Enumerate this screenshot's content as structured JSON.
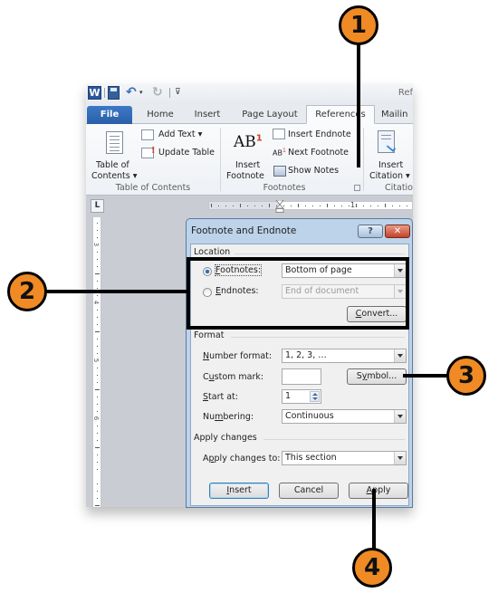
{
  "window": {
    "title_fragment": "Ref",
    "app_icon_letter": "W"
  },
  "quick_access": {
    "save_icon": "save-icon",
    "undo_icon": "undo-icon",
    "redo_icon": "redo-icon",
    "undo_glyph": "↶",
    "redo_glyph": "↻",
    "dropdown_glyph": "▾",
    "customize_glyph": "⊽"
  },
  "tabs": [
    {
      "label": "File"
    },
    {
      "label": "Home"
    },
    {
      "label": "Insert"
    },
    {
      "label": "Page Layout"
    },
    {
      "label": "References",
      "active": true
    },
    {
      "label": "Mailin"
    }
  ],
  "ribbon": {
    "toc_group": {
      "label": "Table of Contents",
      "toc_button_line1": "Table of",
      "toc_button_line2": "Contents ▾",
      "add_text": "Add Text ▾",
      "update_table": "Update Table"
    },
    "footnotes_group": {
      "label": "Footnotes",
      "insert_footnote_line1": "Insert",
      "insert_footnote_line2": "Footnote",
      "insert_endnote": "Insert Endnote",
      "next_footnote": "Next Footnote",
      "show_notes": "Show Notes",
      "ab_glyph": "AB",
      "ab_sup": "1"
    },
    "citations_group": {
      "label": "Citatio",
      "insert_citation_line1": "Insert",
      "insert_citation_line2": "Citation ▾"
    }
  },
  "ruler": {
    "corner_glyph": "L",
    "vertical_numbers": [
      "3",
      "4",
      "5",
      "6"
    ],
    "horizontal_number": "1"
  },
  "dialog": {
    "title": "Footnote and Endnote",
    "help_glyph": "?",
    "close_glyph": "✕",
    "location": {
      "section_label": "Location",
      "footnotes_label_pre": "",
      "footnotes_label_u": "F",
      "footnotes_label_post": "ootnotes:",
      "footnotes_selected": true,
      "footnotes_value": "Bottom of page",
      "endnotes_label_u": "E",
      "endnotes_label_post": "ndnotes:",
      "endnotes_selected": false,
      "endnotes_value": "End of document",
      "convert_label_u": "C",
      "convert_label_post": "onvert..."
    },
    "format": {
      "section_label": "Format",
      "number_format_label_u": "N",
      "number_format_label_post": "umber format:",
      "number_format_value": "1, 2, 3, …",
      "custom_mark_label_pre": "C",
      "custom_mark_label_u": "u",
      "custom_mark_label_post": "stom mark:",
      "custom_mark_value": "",
      "symbol_label_pre": "S",
      "symbol_label_u": "y",
      "symbol_label_post": "mbol...",
      "start_at_label_u": "S",
      "start_at_label_post": "tart at:",
      "start_at_value": "1",
      "numbering_label_pre": "Nu",
      "numbering_label_u": "m",
      "numbering_label_post": "bering:",
      "numbering_value": "Continuous"
    },
    "apply_changes": {
      "section_label": "Apply changes",
      "apply_to_label_pre": "A",
      "apply_to_label_u": "p",
      "apply_to_label_post": "ply changes to:",
      "apply_to_value": "This section"
    },
    "buttons": {
      "insert_u": "I",
      "insert_post": "nsert",
      "cancel": "Cancel",
      "apply_u": "A",
      "apply_post": "pply"
    }
  },
  "callouts": [
    {
      "number": "1",
      "target": "footnotes-dialog-launcher"
    },
    {
      "number": "2",
      "target": "location-section"
    },
    {
      "number": "3",
      "target": "symbol-button"
    },
    {
      "number": "4",
      "target": "apply-button"
    }
  ],
  "colors": {
    "callout_fill": "#f08a24",
    "file_tab": "#2b5fa8",
    "dialog_frame": "#bcd3ea"
  }
}
